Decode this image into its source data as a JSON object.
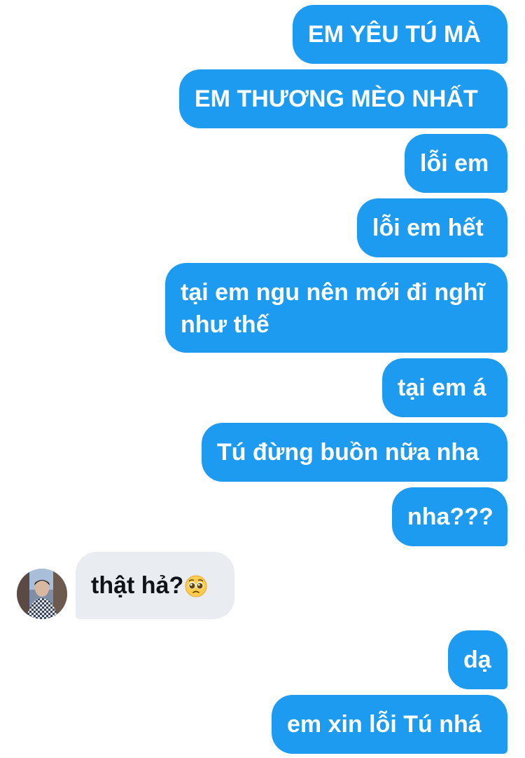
{
  "conversation": {
    "messages": [
      {
        "sender": "me",
        "text": "EM YÊU TÚ MÀ"
      },
      {
        "sender": "me",
        "text": "EM THƯƠNG MÈO NHẤT"
      },
      {
        "sender": "me",
        "text": "lỗi em"
      },
      {
        "sender": "me",
        "text": "lỗi em hết"
      },
      {
        "sender": "me",
        "text": "tại em ngu nên mới đi nghĩ như thế"
      },
      {
        "sender": "me",
        "text": "tại em á"
      },
      {
        "sender": "me",
        "text": "Tú đừng buồn nữa nha"
      },
      {
        "sender": "me",
        "text": "nha???"
      },
      {
        "sender": "other",
        "text": "thật hả?",
        "emoji": "pleading-face"
      },
      {
        "sender": "me",
        "text": "dạ"
      },
      {
        "sender": "me",
        "text": "em xin lỗi Tú nhá"
      }
    ]
  },
  "colors": {
    "outgoing_bubble": "#1d9bf0",
    "incoming_bubble": "#e9ecf0",
    "outgoing_text": "#ffffff",
    "incoming_text": "#0f1419"
  }
}
